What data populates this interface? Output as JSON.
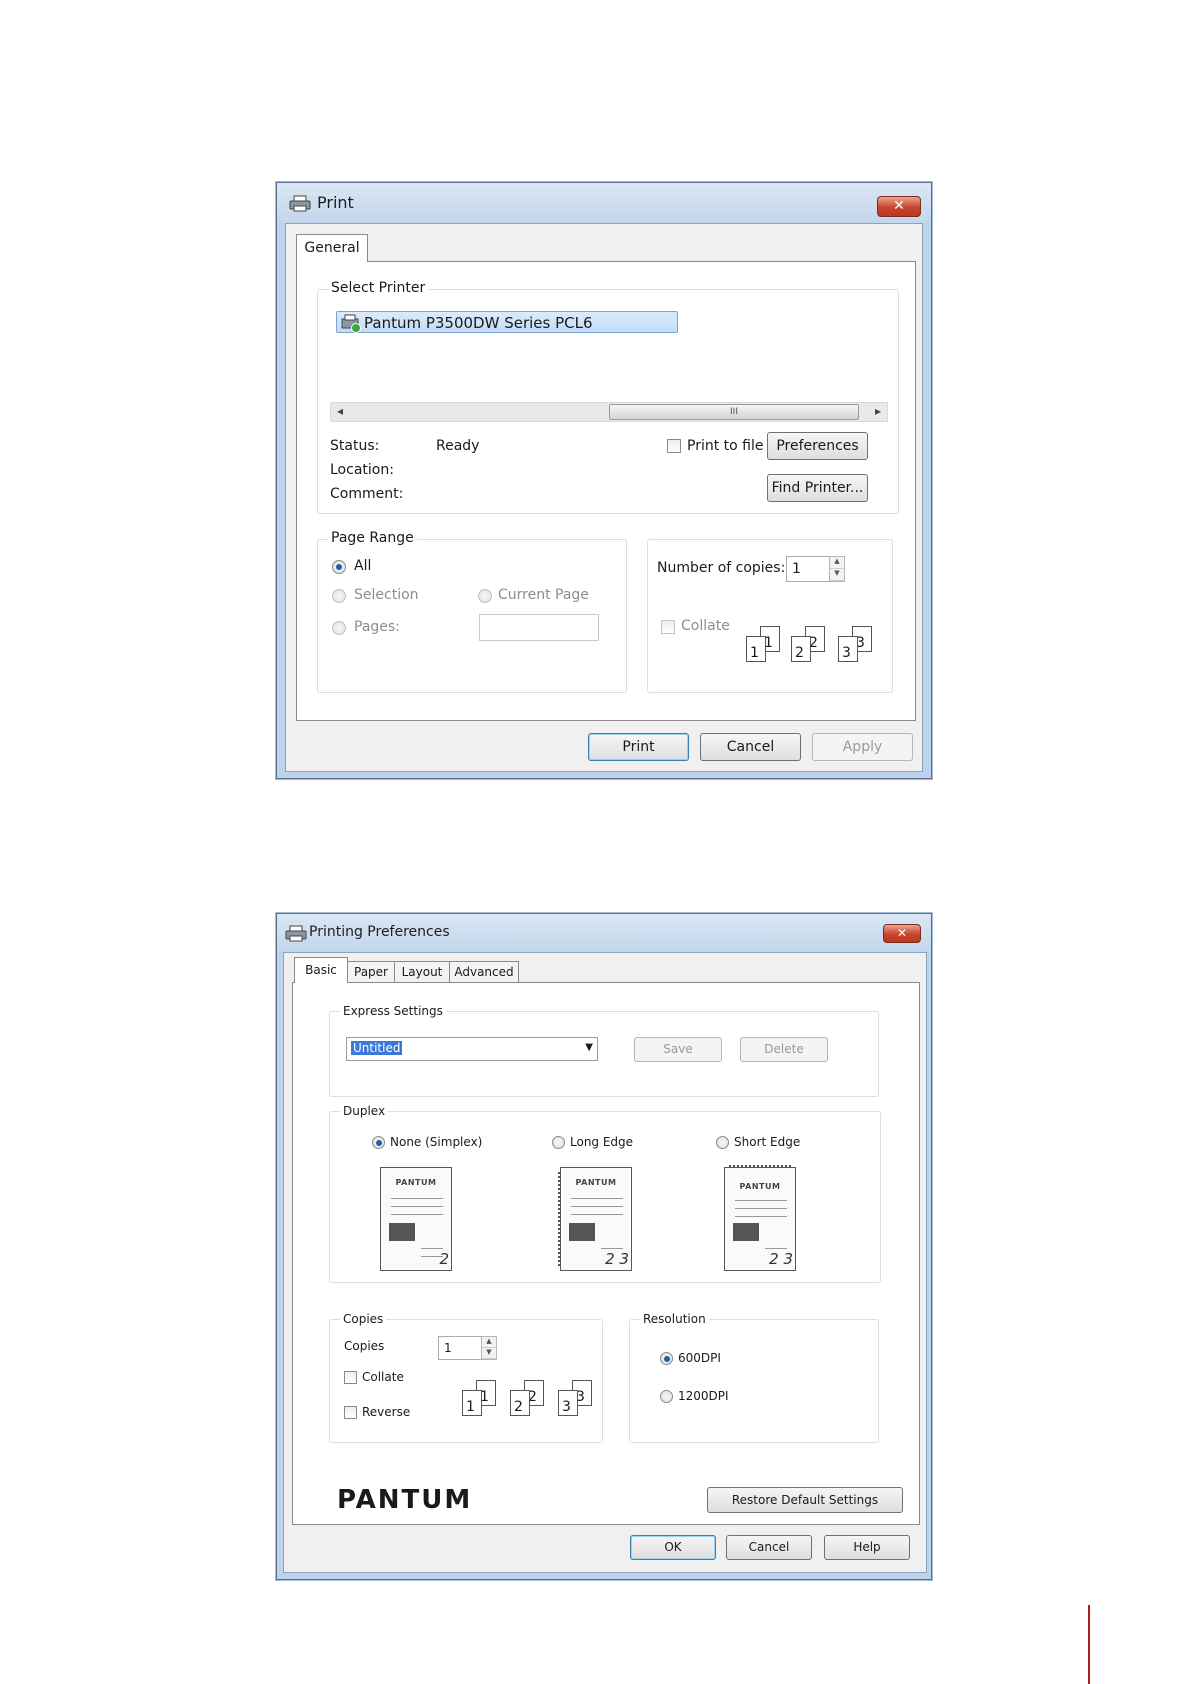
{
  "print_dialog": {
    "title": "Print",
    "close_glyph": "✕",
    "tab_general": "General",
    "select_printer": {
      "legend": "Select Printer",
      "printer_name": "Pantum P3500DW Series PCL6",
      "scroll_thumb": "III",
      "scroll_left": "◂",
      "scroll_right": "▸"
    },
    "status_label": "Status:",
    "status_value": "Ready",
    "location_label": "Location:",
    "comment_label": "Comment:",
    "print_to_file": "Print to file",
    "preferences_button": "Preferences",
    "find_printer_button": "Find Printer...",
    "page_range": {
      "legend": "Page Range",
      "all": "All",
      "selection": "Selection",
      "current_page": "Current Page",
      "pages": "Pages:"
    },
    "copies": {
      "number_label": "Number of copies:",
      "number_value": "1",
      "collate": "Collate",
      "page_sets": [
        {
          "back": "1",
          "front": "1"
        },
        {
          "back": "2",
          "front": "2"
        },
        {
          "back": "3",
          "front": "3"
        }
      ]
    },
    "buttons": {
      "print": "Print",
      "cancel": "Cancel",
      "apply": "Apply"
    }
  },
  "prefs_dialog": {
    "title": "Printing Preferences",
    "close_glyph": "✕",
    "tabs": [
      "Basic",
      "Paper",
      "Layout",
      "Advanced"
    ],
    "express": {
      "legend": "Express Settings",
      "selected": "Untitled",
      "save": "Save",
      "delete": "Delete"
    },
    "duplex": {
      "legend": "Duplex",
      "none": "None (Simplex)",
      "long_edge": "Long Edge",
      "short_edge": "Short Edge",
      "brand": "PANTUM"
    },
    "copies": {
      "legend": "Copies",
      "label": "Copies",
      "value": "1",
      "collate": "Collate",
      "reverse": "Reverse"
    },
    "resolution": {
      "legend": "Resolution",
      "dpi600": "600DPI",
      "dpi1200": "1200DPI"
    },
    "logo": "PANTUM",
    "restore_button": "Restore Default Settings",
    "buttons": {
      "ok": "OK",
      "cancel": "Cancel",
      "help": "Help"
    }
  }
}
